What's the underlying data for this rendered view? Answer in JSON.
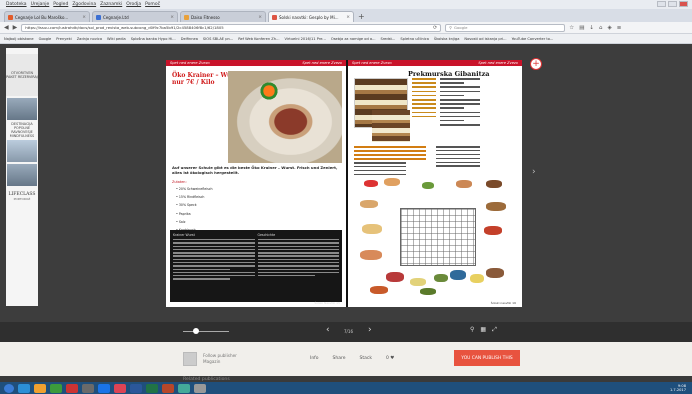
{
  "menubar": [
    "Datoteka",
    "Urejanje",
    "Pogled",
    "Zgodovina",
    "Zaznamki",
    "Orodja",
    "Pomoč"
  ],
  "tabs": [
    {
      "label": "Cegnarje Lol Bu Maroško...",
      "color": "#e25b2a",
      "active": false
    },
    {
      "label": "Cegnarje.Ltd",
      "color": "#3b6fd3",
      "active": false
    },
    {
      "label": "Daiso Fitnesso",
      "color": "#e9a13b",
      "active": false
    },
    {
      "label": "Šolski nasvtki: Gesplo by Mi...",
      "color": "#d54",
      "active": true
    }
  ],
  "newtab_label": "+",
  "address": {
    "url": "https://issuu.com/lustrahdk/docs/sol_prod_revista_web-subcong_d0f9c7ba5b91/2c4588406f8c1/62/1805",
    "search_placeholder": "Google"
  },
  "bookmarks": [
    "Najbolj obiskane",
    "Google",
    "Prenyeki",
    "Zadnja novica",
    "Wiki pedia",
    "Splošna banka Hypo Hi...",
    "Delfinnea",
    "SIOS SBLAE pn...",
    "Ref Web Konferen Zh...",
    "Virtuelni 2016/11 Pre...",
    "Osebja za namige od a...",
    "Sredst...",
    "Spletna učilnica",
    "Školska knjiga",
    "Novosti od iskanja pri...",
    "YouTube Converter to..."
  ],
  "ad": {
    "heading": "OTVORITVEN PAKET REZERVIRAJ",
    "mid_text": "DESTINACIJA POPOLNE RAVNOVESJE MINDFULNESS",
    "logo": "LIFECLASS",
    "logo_sub": "PORTOROŽ"
  },
  "magazine": {
    "header_left_left": "Spet ned enere Zvezo",
    "header_left_right": "Spet ned enere Zvezo",
    "header_right_left": "Spet ned enere Zvezo",
    "header_right_right": "Spet ned enere Zvezo",
    "left_title": "Öko Krainer – Wurst nur 7€ / Kilo",
    "left_subtitle": "Auf unserer Schule gibt es die beste Öko Krainer – Wurst. Frisch und Zeniert, alles ist ökologisch hergestellt.",
    "left_red_label": "Zutaten:",
    "left_list": [
      "20% Schweinefleisch",
      "15% Rindfleisch",
      "30% Speck",
      "Paprika",
      "Salz",
      "Knoblauch"
    ],
    "dark_col1_head": "Krainer Wurst",
    "dark_col2_head": "Geschichte",
    "left_page_no": "Šolski Nasvtki 15",
    "right_title": "Prekmurska Gibanitza",
    "right_footer": "Šolski nasvtki 16"
  },
  "controls": {
    "page_indicator": "7/16",
    "prev": "‹",
    "next": "›"
  },
  "publisher": {
    "name": "Follow publisher",
    "sub": "Magazin"
  },
  "info_links": [
    "Info",
    "Share",
    "Stack",
    "0 ♥"
  ],
  "publish_button": "YOU CAN PUBLISH THIS",
  "related_label": "Related publications",
  "tray": {
    "time": "9:08",
    "date": "1.7.2017"
  },
  "taskbar_apps": [
    "#2c8fd6",
    "#f0a030",
    "#3c9b3c",
    "#c33",
    "#6a6a6a",
    "#1a73e8",
    "#d45",
    "#2b579a",
    "#217346",
    "#b7472a",
    "#4a9",
    "#999"
  ]
}
